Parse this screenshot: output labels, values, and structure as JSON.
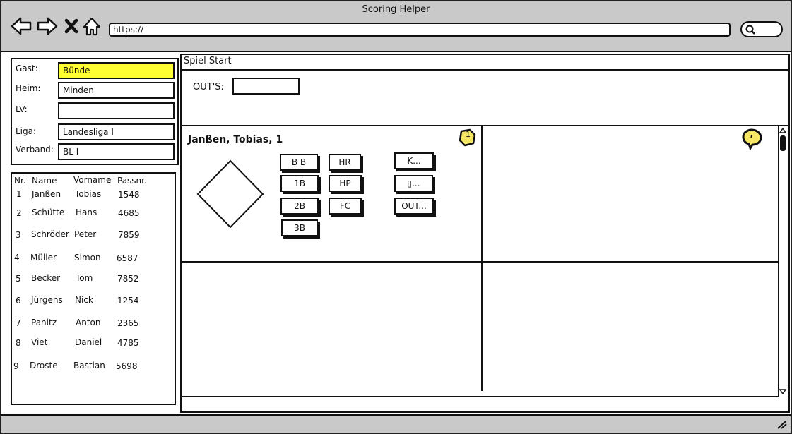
{
  "window": {
    "title": "Scoring Helper"
  },
  "browser": {
    "url": "https://",
    "icons": [
      "back-arrow-icon",
      "forward-arrow-icon",
      "close-x-icon",
      "home-icon",
      "search-icon"
    ]
  },
  "form": {
    "gast_label": "Gast:",
    "gast_value": "Bünde",
    "heim_label": "Heim:",
    "heim_value": "Minden",
    "lv_label": "LV:",
    "lv_value": "",
    "liga_label": "Liga:",
    "liga_value": "Landesliga I",
    "verband_label": "Verband:",
    "verband_value": "BL I",
    "highlight_color": "#ffff33"
  },
  "roster": {
    "headers": {
      "nr": "Nr.",
      "name": "Name",
      "vorname": "Vorname",
      "passnr": "Passnr."
    },
    "rows": [
      {
        "nr": "1",
        "name": "Janßen",
        "vorname": "Tobias",
        "passnr": "1548"
      },
      {
        "nr": "2",
        "name": "Schütte",
        "vorname": "Hans",
        "passnr": "4685"
      },
      {
        "nr": "3",
        "name": "Schröder",
        "vorname": "Peter",
        "passnr": "7859"
      },
      {
        "nr": "4",
        "name": "Müller",
        "vorname": "Simon",
        "passnr": "6587"
      },
      {
        "nr": "5",
        "name": "Becker",
        "vorname": "Tom",
        "passnr": "7852"
      },
      {
        "nr": "6",
        "name": "Jürgens",
        "vorname": "Nick",
        "passnr": "1254"
      },
      {
        "nr": "7",
        "name": "Panitz",
        "vorname": "Anton",
        "passnr": "2365"
      },
      {
        "nr": "8",
        "name": "Viet",
        "vorname": "Daniel",
        "passnr": "4785"
      },
      {
        "nr": "9",
        "name": "Droste",
        "vorname": "Bastian",
        "passnr": "5698"
      }
    ]
  },
  "main": {
    "title": "Spiel Start",
    "outs_label": "OUT'S:",
    "outs_value": "",
    "player_card": {
      "player": "Janßen, Tobias, 1",
      "badge_number": "1",
      "buttons": {
        "bb": "B B",
        "hr": "HR",
        "k": "K...",
        "b1": "1B",
        "hp": "HP",
        "unknown": "▯...",
        "b2": "2B",
        "fc": "FC",
        "out": "OUT...",
        "b3": "3B"
      }
    },
    "badge_color": "#f5e663"
  }
}
